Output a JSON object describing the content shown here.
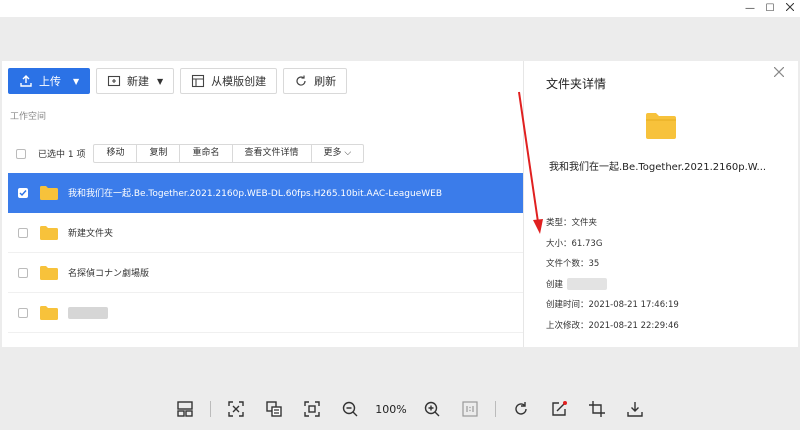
{
  "window": {
    "minimize": "—",
    "maximize": "☐"
  },
  "toolbar": {
    "upload": "上传",
    "new": "新建",
    "from_template": "从模版创建",
    "refresh": "刷新"
  },
  "workspace_label": "工作空间",
  "actionbar": {
    "selected": "已选中 1 项",
    "actions": [
      "移动",
      "复制",
      "重命名",
      "查看文件详情",
      "更多"
    ]
  },
  "files": [
    {
      "name": "我和我们在一起.Be.Together.2021.2160p.WEB-DL.60fps.H265.10bit.AAC-LeagueWEB",
      "selected": true
    },
    {
      "name": "新建文件夹",
      "selected": false
    },
    {
      "name": "名探偵コナン劇場版",
      "selected": false
    },
    {
      "name": "",
      "selected": false
    }
  ],
  "details": {
    "title": "文件夹详情",
    "folder_name": "我和我们在一起.Be.Together.2021.2160p.W...",
    "type": "类型：文件夹",
    "size": "大小：61.73G",
    "count": "文件个数：35",
    "creator": "创建",
    "created": "创建时间：2021-08-21 17:46:19",
    "modified": "上次修改：2021-08-21 22:29:46"
  },
  "viewer": {
    "zoom": "100%"
  },
  "colors": {
    "accent": "#2b72e6",
    "selected_row": "#3b7cea",
    "folder": "#f7c23b",
    "arrow": "#e02020"
  }
}
